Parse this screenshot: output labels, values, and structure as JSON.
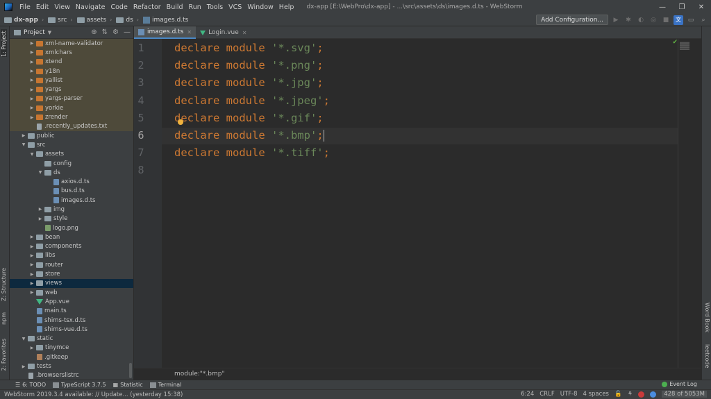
{
  "menu": [
    "File",
    "Edit",
    "View",
    "Navigate",
    "Code",
    "Refactor",
    "Build",
    "Run",
    "Tools",
    "VCS",
    "Window",
    "Help"
  ],
  "window_title": "dx-app [E:\\WebPro\\dx-app] - ...\\src\\assets\\ds\\images.d.ts - WebStorm",
  "navbar": {
    "crumbs": [
      "dx-app",
      "src",
      "assets",
      "ds",
      "images.d.ts"
    ],
    "add_config": "Add Configuration..."
  },
  "left_strip": {
    "project": "1: Project",
    "structure": "Z: Structure",
    "npm": "npm",
    "favorites": "2: Favorites"
  },
  "right_strip": {
    "wordbook": "Word Book",
    "leetcode": "leetcode"
  },
  "project_panel": {
    "title": "Project",
    "tree": [
      {
        "label": "xml-name-validator",
        "indent": 2,
        "icon": "folder-orange",
        "arrow": "▶",
        "state": "excluded"
      },
      {
        "label": "xmlchars",
        "indent": 2,
        "icon": "folder-orange",
        "arrow": "▶",
        "state": "excluded"
      },
      {
        "label": "xtend",
        "indent": 2,
        "icon": "folder-orange",
        "arrow": "▶",
        "state": "excluded"
      },
      {
        "label": "y18n",
        "indent": 2,
        "icon": "folder-orange",
        "arrow": "▶",
        "state": "excluded"
      },
      {
        "label": "yallist",
        "indent": 2,
        "icon": "folder-orange",
        "arrow": "▶",
        "state": "excluded"
      },
      {
        "label": "yargs",
        "indent": 2,
        "icon": "folder-orange",
        "arrow": "▶",
        "state": "excluded"
      },
      {
        "label": "yargs-parser",
        "indent": 2,
        "icon": "folder-orange",
        "arrow": "▶",
        "state": "excluded"
      },
      {
        "label": "yorkie",
        "indent": 2,
        "icon": "folder-orange",
        "arrow": "▶",
        "state": "excluded"
      },
      {
        "label": "zrender",
        "indent": 2,
        "icon": "folder-orange",
        "arrow": "▶",
        "state": "excluded"
      },
      {
        "label": ".recently_updates.txt",
        "indent": 2,
        "icon": "file",
        "arrow": "",
        "state": "excluded"
      },
      {
        "label": "public",
        "indent": 1,
        "icon": "folder-gray",
        "arrow": "▶",
        "state": ""
      },
      {
        "label": "src",
        "indent": 1,
        "icon": "folder-gray",
        "arrow": "▼",
        "state": ""
      },
      {
        "label": "assets",
        "indent": 2,
        "icon": "folder-gray",
        "arrow": "▼",
        "state": ""
      },
      {
        "label": "config",
        "indent": 3,
        "icon": "folder-gray",
        "arrow": "",
        "state": ""
      },
      {
        "label": "ds",
        "indent": 3,
        "icon": "folder-gray",
        "arrow": "▼",
        "state": ""
      },
      {
        "label": "axios.d.ts",
        "indent": 4,
        "icon": "ts",
        "arrow": "",
        "state": ""
      },
      {
        "label": "bus.d.ts",
        "indent": 4,
        "icon": "ts",
        "arrow": "",
        "state": ""
      },
      {
        "label": "images.d.ts",
        "indent": 4,
        "icon": "ts",
        "arrow": "",
        "state": ""
      },
      {
        "label": "img",
        "indent": 3,
        "icon": "folder-gray",
        "arrow": "▶",
        "state": ""
      },
      {
        "label": "style",
        "indent": 3,
        "icon": "folder-gray",
        "arrow": "▶",
        "state": ""
      },
      {
        "label": "logo.png",
        "indent": 3,
        "icon": "png",
        "arrow": "",
        "state": ""
      },
      {
        "label": "bean",
        "indent": 2,
        "icon": "folder-gray",
        "arrow": "▶",
        "state": ""
      },
      {
        "label": "components",
        "indent": 2,
        "icon": "folder-gray",
        "arrow": "▶",
        "state": ""
      },
      {
        "label": "libs",
        "indent": 2,
        "icon": "folder-gray",
        "arrow": "▶",
        "state": ""
      },
      {
        "label": "router",
        "indent": 2,
        "icon": "folder-gray",
        "arrow": "▶",
        "state": ""
      },
      {
        "label": "store",
        "indent": 2,
        "icon": "folder-gray",
        "arrow": "▶",
        "state": ""
      },
      {
        "label": "views",
        "indent": 2,
        "icon": "folder-gray",
        "arrow": "▶",
        "state": "selected"
      },
      {
        "label": "web",
        "indent": 2,
        "icon": "folder-gray",
        "arrow": "▶",
        "state": ""
      },
      {
        "label": "App.vue",
        "indent": 2,
        "icon": "vue",
        "arrow": "",
        "state": ""
      },
      {
        "label": "main.ts",
        "indent": 2,
        "icon": "ts",
        "arrow": "",
        "state": ""
      },
      {
        "label": "shims-tsx.d.ts",
        "indent": 2,
        "icon": "ts",
        "arrow": "",
        "state": ""
      },
      {
        "label": "shims-vue.d.ts",
        "indent": 2,
        "icon": "ts",
        "arrow": "",
        "state": ""
      },
      {
        "label": "static",
        "indent": 1,
        "icon": "folder-gray",
        "arrow": "▼",
        "state": ""
      },
      {
        "label": "tinymce",
        "indent": 2,
        "icon": "folder-gray",
        "arrow": "▶",
        "state": ""
      },
      {
        "label": ".gitkeep",
        "indent": 2,
        "icon": "git",
        "arrow": "",
        "state": ""
      },
      {
        "label": "tests",
        "indent": 1,
        "icon": "folder-gray",
        "arrow": "▶",
        "state": ""
      },
      {
        "label": ".browserslistrc",
        "indent": 1,
        "icon": "file",
        "arrow": "",
        "state": ""
      }
    ]
  },
  "editor": {
    "tabs": [
      {
        "label": "images.d.ts",
        "icon": "ts",
        "active": true
      },
      {
        "label": "Login.vue",
        "icon": "vue",
        "active": false
      }
    ],
    "line_numbers": [
      "1",
      "2",
      "3",
      "4",
      "5",
      "6",
      "7",
      "8"
    ],
    "current_line": 6,
    "lines": [
      {
        "kw": "declare module ",
        "str": "'*.svg'",
        "end": ";"
      },
      {
        "kw": "declare module ",
        "str": "'*.png'",
        "end": ";"
      },
      {
        "kw": "declare module ",
        "str": "'*.jpg'",
        "end": ";"
      },
      {
        "kw": "declare module ",
        "str": "'*.jpeg'",
        "end": ";"
      },
      {
        "kw": "declare module ",
        "str": "'*.gif'",
        "end": ";"
      },
      {
        "kw": "declare module ",
        "str": "'*.bmp'",
        "end": ";"
      },
      {
        "kw": "declare module ",
        "str": "'*.tiff'",
        "end": ";"
      }
    ],
    "breadcrumb": "module:\"*.bmp\""
  },
  "tool_tabs": [
    "6: TODO",
    "TypeScript 3.7.5",
    "Statistic",
    "Terminal"
  ],
  "event_log": "Event Log",
  "status": {
    "message": "WebStorm 2019.3.4 available: // Update... (yesterday 15:38)",
    "position": "6:24",
    "line_sep": "CRLF",
    "encoding": "UTF-8",
    "indent": "4 spaces",
    "memory": "428 of 5053M"
  }
}
